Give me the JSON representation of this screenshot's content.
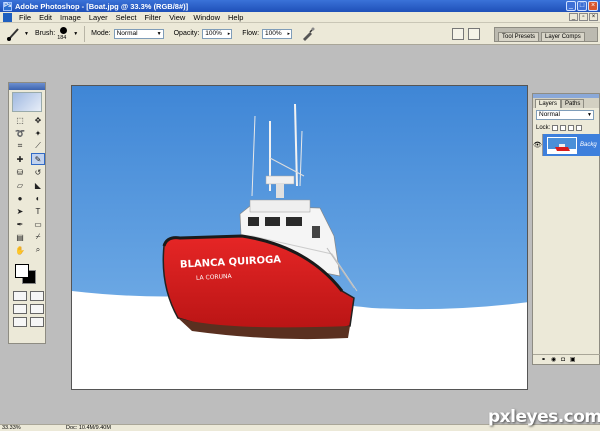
{
  "titlebar": {
    "title": "Adobe Photoshop - [Boat.jpg @ 33.3% (RGB/8#)]"
  },
  "menubar": {
    "items": [
      "File",
      "Edit",
      "Image",
      "Layer",
      "Select",
      "Filter",
      "View",
      "Window",
      "Help"
    ]
  },
  "options": {
    "brush_label": "Brush:",
    "brush_size": "184",
    "mode_label": "Mode:",
    "mode_value": "Normal",
    "opacity_label": "Opacity:",
    "opacity_value": "100%",
    "flow_label": "Flow:",
    "flow_value": "100%"
  },
  "palette_well": {
    "tabs": [
      "Tool Presets",
      "Layer Comps"
    ]
  },
  "document": {
    "boat_name": "BLANCA QUIROGA",
    "home_port": "LA CORUNA"
  },
  "layers": {
    "tabs": [
      "Layers",
      "Paths"
    ],
    "blend_mode": "Normal",
    "lock_label": "Lock:",
    "layer_name": "Backg"
  },
  "status": {
    "zoom": "33.33%",
    "doc_size": "Doc: 10.4M/9.40M"
  },
  "watermark": "pxleyes.com",
  "colors": {
    "sky": "#4a8fd8",
    "hull_red": "#d81c1c",
    "selection_blue": "#3d7fdc",
    "foreground": "#ffffff",
    "background": "#000000"
  }
}
